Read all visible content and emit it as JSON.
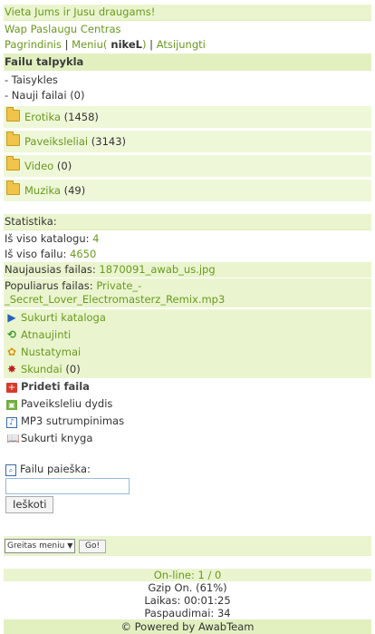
{
  "header": {
    "title": "Vieta Jums ir Jusu draugams!",
    "subtitle": "Wap Paslaugu Centras"
  },
  "nav": {
    "home": "Pagrindinis",
    "sep1": " | ",
    "menu_prefix": "Meniu(",
    "user": " nikeL",
    "menu_suffix": ")",
    "sep2": " | ",
    "logout": "Atsijungti"
  },
  "section": {
    "title": "Failu talpykla",
    "rules": "- Taisykles",
    "new_files_label": "- Nauji failai",
    "new_files_count": "(0)"
  },
  "categories": [
    {
      "name": "Erotika",
      "count": "(1458)"
    },
    {
      "name": "Paveiksleliai",
      "count": "(3143)"
    },
    {
      "name": "Video",
      "count": "(0)"
    },
    {
      "name": "Muzika",
      "count": "(49)"
    }
  ],
  "stats": {
    "title": "Statistika:",
    "catalogs_label": "Iš viso katalogu:",
    "catalogs_value": "4",
    "files_label": "Iš viso failu:",
    "files_value": "4650",
    "newest_label": "Naujausias failas:",
    "newest_value": "1870091_awab_us.jpg",
    "popular_label": "Populiarus failas:",
    "popular_value_1": "Private_-",
    "popular_value_2": "_Secret_Lover_Electromasterz_Remix.mp3"
  },
  "admin": {
    "create_catalog": "Sukurti kataloga",
    "refresh": "Atnaujinti",
    "settings": "Nustatymai",
    "complaints": "Skundai",
    "complaints_count": "(0)"
  },
  "tools": {
    "add_file": "Prideti faila",
    "image_size": "Paveiksleliu dydis",
    "mp3_cut": "MP3 sutrumpinimas",
    "make_book": "Sukurti knyga"
  },
  "search": {
    "label": "Failu paieška:",
    "button": "Ieškoti",
    "value": ""
  },
  "quick_menu": {
    "selected": "Greitas meniu",
    "go": "Go!"
  },
  "footer": {
    "online": "On-line: 1 / 0",
    "gzip": "Gzip On. (61%)",
    "time": "Laikas: 00:01:25",
    "clicks": "Paspaudimai: 34",
    "powered": "© Powered by AwabTeam"
  },
  "colors": {
    "accent_green": "#6a9a1e",
    "highlight_bg": "#eaf5cf",
    "category_bg": "#eef7d8"
  }
}
